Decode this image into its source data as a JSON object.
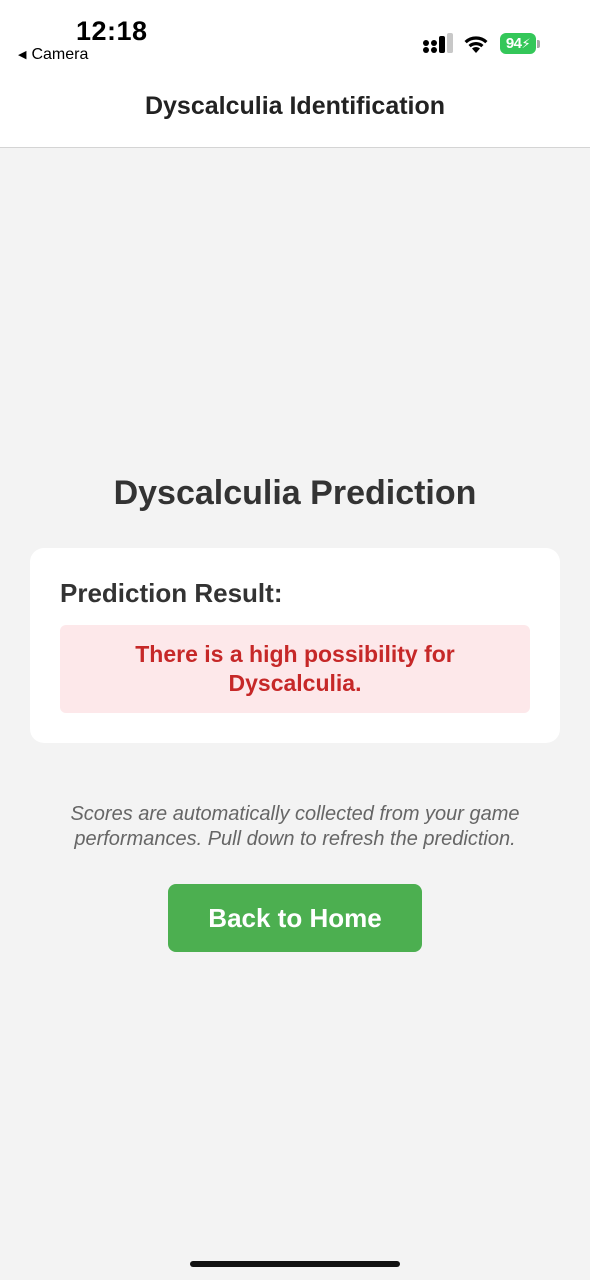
{
  "status_bar": {
    "time": "12:18",
    "back_app": "Camera",
    "battery_level": "94",
    "battery_charging": true,
    "icons": [
      "cellular-signal-icon",
      "wifi-icon",
      "battery-icon"
    ]
  },
  "header": {
    "title": "Dyscalculia Identification"
  },
  "main": {
    "heading": "Dyscalculia Prediction",
    "result_label": "Prediction Result:",
    "result_text": "There is a high possibility for Dyscalculia.",
    "info_text": "Scores are automatically collected from your game performances. Pull down to refresh the prediction.",
    "home_button_label": "Back to Home"
  },
  "colors": {
    "background": "#f3f3f3",
    "card": "#ffffff",
    "result_bg": "#fde8ea",
    "result_text": "#c62828",
    "button": "#4caf50",
    "battery": "#34c759"
  }
}
